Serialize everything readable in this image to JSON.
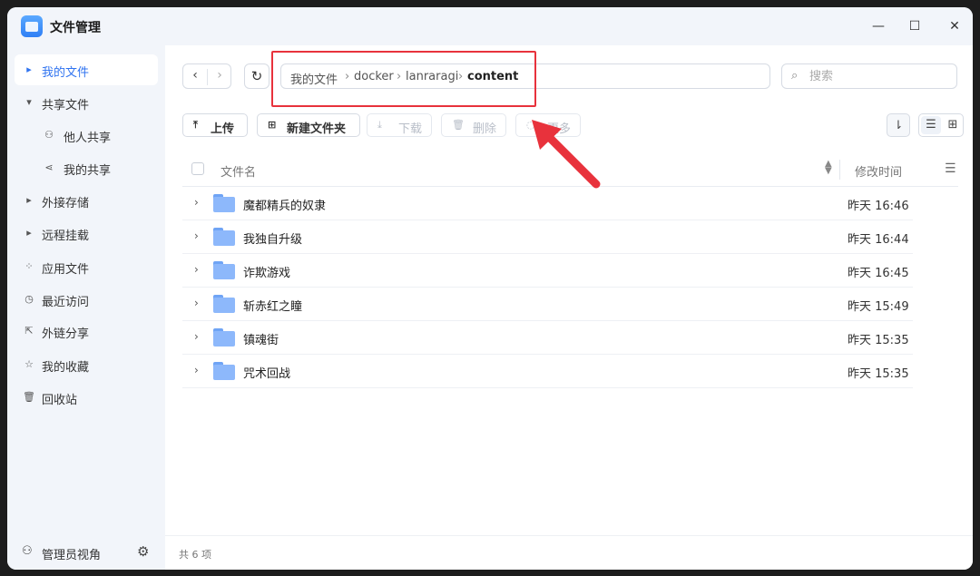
{
  "app": {
    "title": "文件管理"
  },
  "window_controls": {
    "minimize": "—",
    "maximize": "☐",
    "close": "✕"
  },
  "sidebar": {
    "items": [
      {
        "label": "我的文件",
        "icon": "caret-right-icon",
        "glyph": "▸",
        "active": true
      },
      {
        "label": "共享文件",
        "icon": "caret-down-icon",
        "glyph": "▾"
      },
      {
        "label": "他人共享",
        "icon": "user-icon",
        "glyph": "⚇"
      },
      {
        "label": "我的共享",
        "icon": "share-icon",
        "glyph": "⋖"
      },
      {
        "label": "外接存储",
        "icon": "caret-right-icon",
        "glyph": "▸"
      },
      {
        "label": "远程挂载",
        "icon": "caret-right-icon",
        "glyph": "▸"
      },
      {
        "label": "应用文件",
        "icon": "apps-grid-icon",
        "glyph": "⁘"
      },
      {
        "label": "最近访问",
        "icon": "clock-icon",
        "glyph": "◷"
      },
      {
        "label": "外链分享",
        "icon": "external-link-icon",
        "glyph": "⇱"
      },
      {
        "label": "我的收藏",
        "icon": "star-icon",
        "glyph": "☆"
      },
      {
        "label": "回收站",
        "icon": "trash-icon",
        "glyph": "🗑"
      }
    ],
    "footer": {
      "label": "管理员视角",
      "icon": "admin-user-icon",
      "glyph": "⚇",
      "settings_glyph": "⚙"
    }
  },
  "nav": {
    "back": "‹",
    "forward": "›",
    "refresh": "↻"
  },
  "breadcrumb": {
    "segments": [
      "我的文件",
      "docker",
      "lanraragi",
      "content"
    ],
    "separator": "›"
  },
  "search": {
    "placeholder": "搜索",
    "icon": "search-icon",
    "glyph": "⌕"
  },
  "toolbar": {
    "upload": {
      "label": "上传",
      "glyph": "⤒"
    },
    "new_folder": {
      "label": "新建文件夹",
      "glyph": "⊞"
    },
    "download": {
      "label": "下载",
      "glyph": "⤓"
    },
    "delete": {
      "label": "删除",
      "glyph": "🗑"
    },
    "more": {
      "label": "更多",
      "glyph": "◌"
    },
    "sort_glyph": "⇂",
    "list_view_glyph": "☰",
    "grid_view_glyph": "⊞"
  },
  "table": {
    "headers": {
      "name": "文件名",
      "modified": "修改时间"
    },
    "rows": [
      {
        "name": "魔都精兵的奴隶",
        "modified": "昨天 16:46"
      },
      {
        "name": "我独自升级",
        "modified": "昨天 16:44"
      },
      {
        "name": "诈欺游戏",
        "modified": "昨天 16:45"
      },
      {
        "name": "斩赤红之瞳",
        "modified": "昨天 15:49"
      },
      {
        "name": "镇魂街",
        "modified": "昨天 15:35"
      },
      {
        "name": "咒术回战",
        "modified": "昨天 15:35"
      }
    ]
  },
  "status": {
    "count_text": "共 6 项"
  },
  "colors": {
    "accent": "#2f73f0",
    "highlight_box": "#e8323c",
    "folder": "#8db8fb",
    "sidebar_bg": "#f2f5fa"
  }
}
